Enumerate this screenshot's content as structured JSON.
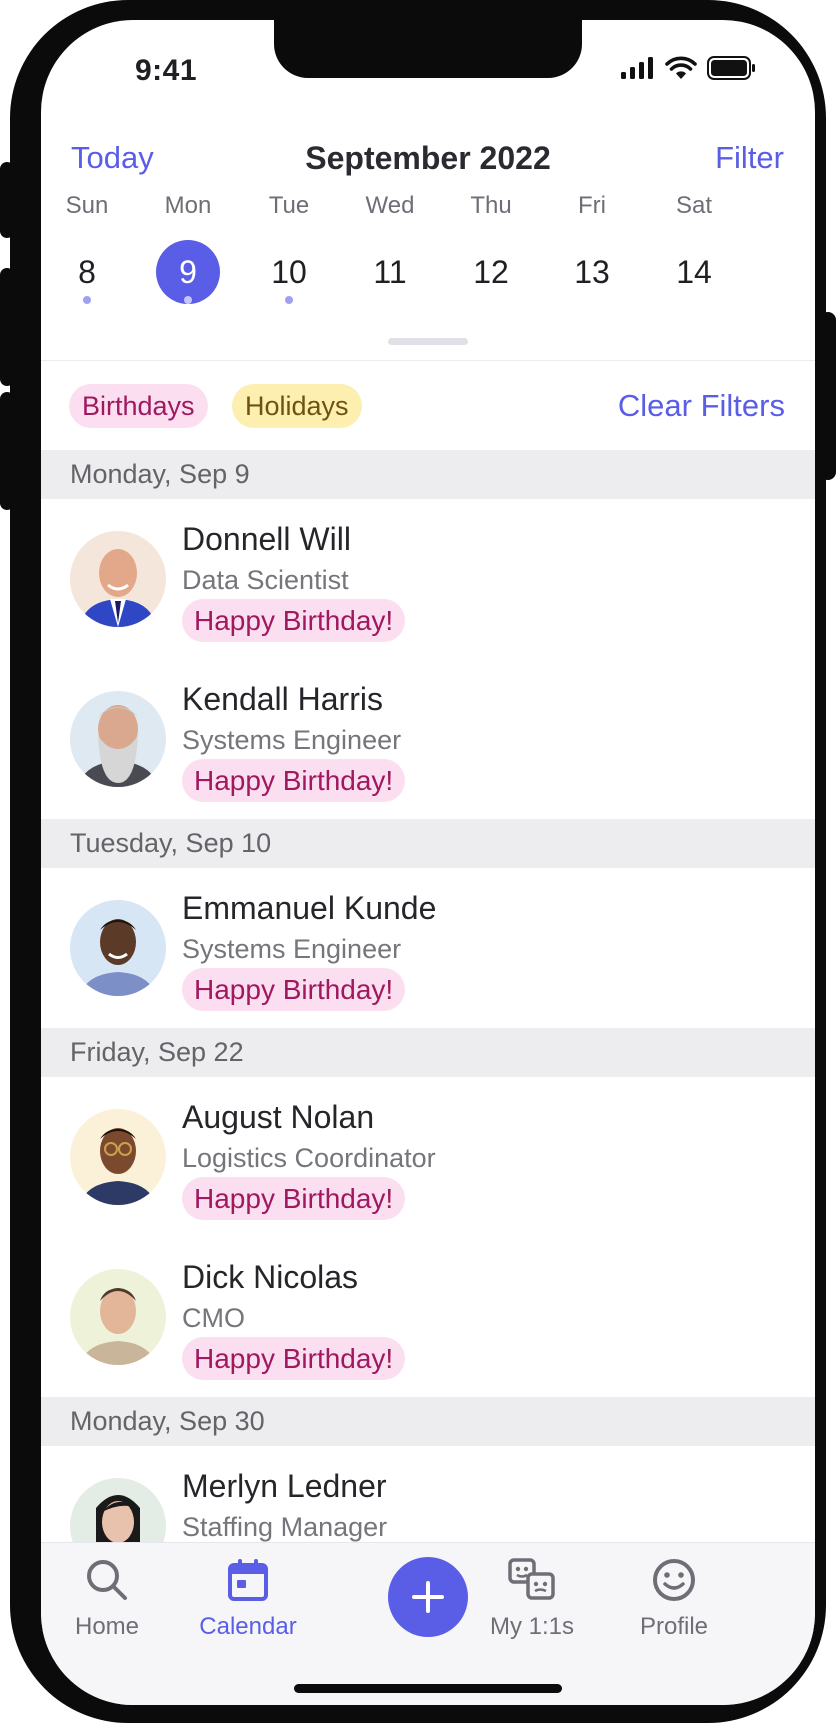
{
  "status": {
    "time": "9:41"
  },
  "header": {
    "today": "Today",
    "title": "September 2022",
    "filter": "Filter"
  },
  "week": [
    {
      "name": "Sun",
      "num": "8",
      "dot": true,
      "selected": false
    },
    {
      "name": "Mon",
      "num": "9",
      "dot": true,
      "selected": true
    },
    {
      "name": "Tue",
      "num": "10",
      "dot": true,
      "selected": false
    },
    {
      "name": "Wed",
      "num": "11",
      "dot": false,
      "selected": false
    },
    {
      "name": "Thu",
      "num": "12",
      "dot": false,
      "selected": false
    },
    {
      "name": "Fri",
      "num": "13",
      "dot": false,
      "selected": false
    },
    {
      "name": "Sat",
      "num": "14",
      "dot": false,
      "selected": false
    }
  ],
  "filters": {
    "chips": [
      "Birthdays",
      "Holidays"
    ],
    "clear": "Clear Filters"
  },
  "sections": [
    {
      "title": "Monday, Sep 9",
      "people": [
        {
          "name": "Donnell Will",
          "role": "Data Scientist",
          "badge": "Happy Birthday!"
        },
        {
          "name": "Kendall Harris",
          "role": "Systems Engineer",
          "badge": "Happy Birthday!"
        }
      ]
    },
    {
      "title": "Tuesday, Sep 10",
      "people": [
        {
          "name": "Emmanuel Kunde",
          "role": "Systems Engineer",
          "badge": "Happy Birthday!"
        }
      ]
    },
    {
      "title": "Friday, Sep 22",
      "people": [
        {
          "name": "August Nolan",
          "role": "Logistics Coordinator",
          "badge": "Happy Birthday!"
        },
        {
          "name": "Dick Nicolas",
          "role": "CMO",
          "badge": "Happy Birthday!"
        }
      ]
    },
    {
      "title": "Monday, Sep 30",
      "people": [
        {
          "name": "Merlyn Ledner",
          "role": "Staffing Manager",
          "badge": ""
        }
      ]
    }
  ],
  "tabs": {
    "home": "Home",
    "calendar": "Calendar",
    "one_on_ones": "My 1:1s",
    "profile": "Profile"
  },
  "colors": {
    "accent": "#5a5ee6",
    "birthday_bg": "#fbdff0",
    "birthday_text": "#a01860",
    "holiday_bg": "#fcefb0"
  }
}
